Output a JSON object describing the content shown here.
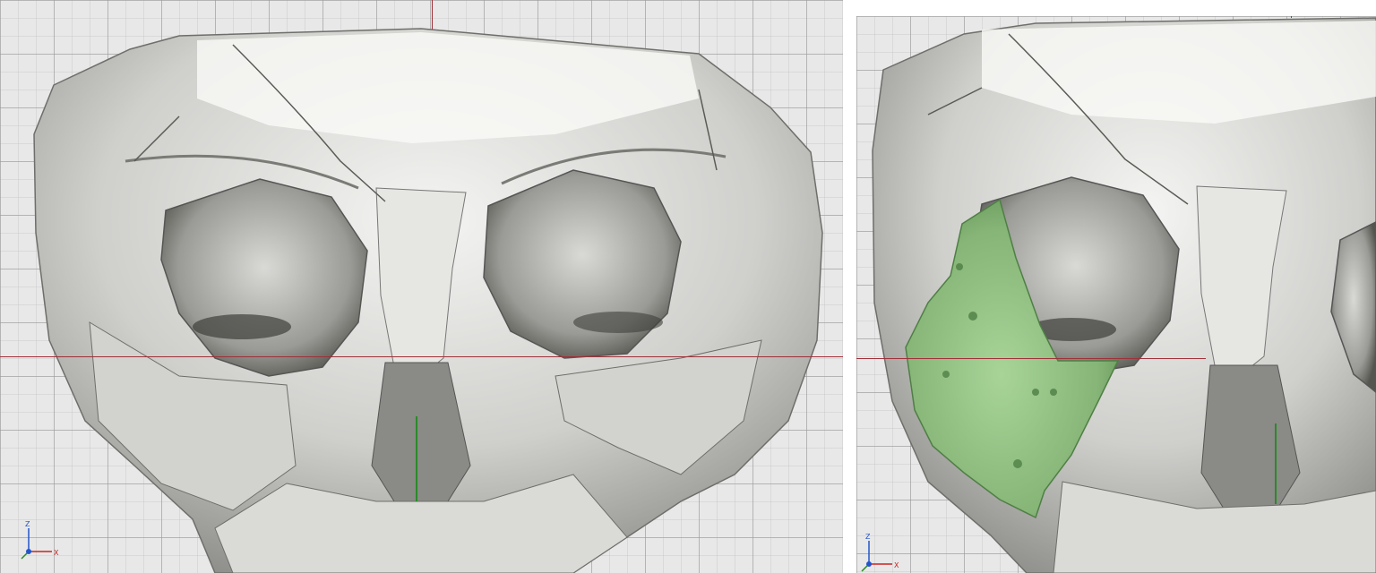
{
  "viewports": [
    {
      "id": "left",
      "label": "",
      "implant": false
    },
    {
      "id": "right",
      "label": "",
      "implant": true
    }
  ],
  "triad": {
    "z_label": "Z",
    "x_label": "X"
  },
  "colors": {
    "bone": "#c9c9c6",
    "bone_shadow": "#7e7e7a",
    "implant": "#8fbf7f",
    "implant_dark": "#5e8f52",
    "axis_red": "#a0303a",
    "axis_green": "#2a8a2a",
    "grid_bg": "#e8e8e8"
  }
}
